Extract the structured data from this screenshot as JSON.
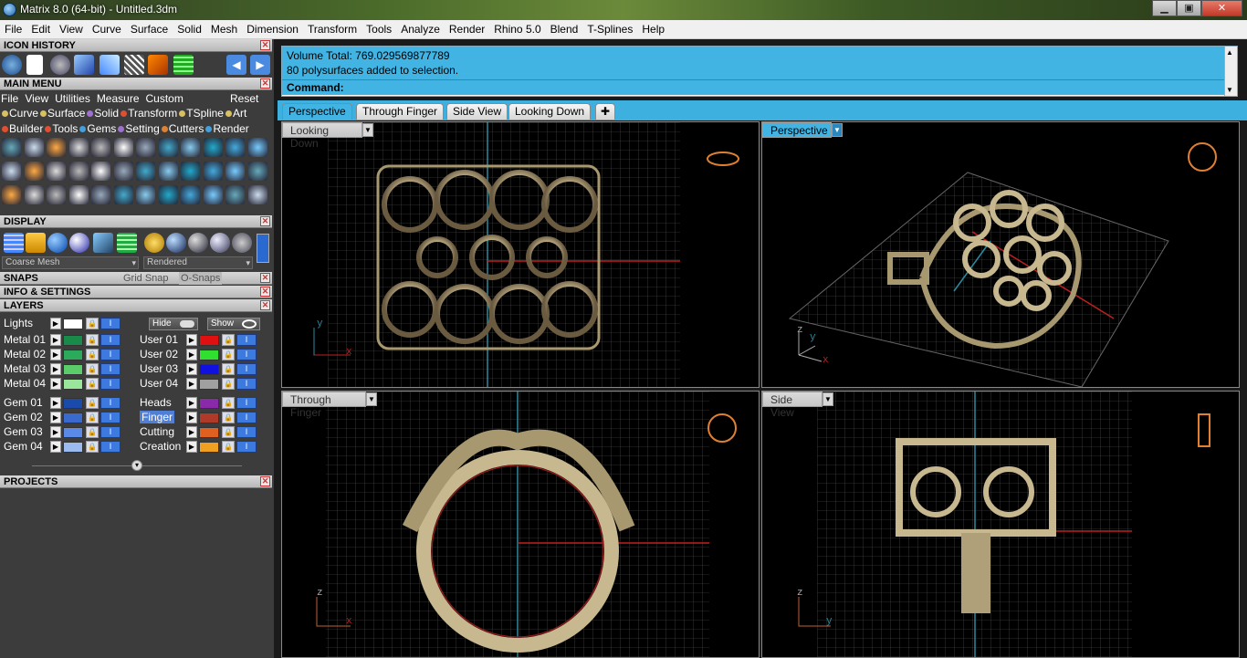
{
  "window": {
    "title": "Matrix 8.0 (64-bit) - Untitled.3dm",
    "minimize": "▁",
    "maximize": "▣",
    "close": "✕"
  },
  "menubar": [
    "File",
    "Edit",
    "View",
    "Curve",
    "Surface",
    "Solid",
    "Mesh",
    "Dimension",
    "Transform",
    "Tools",
    "Analyze",
    "Render",
    "Rhino 5.0",
    "Blend",
    "T-Splines",
    "Help"
  ],
  "panels": {
    "icon_history": "ICON HISTORY",
    "main_menu": "MAIN MENU",
    "display": "DISPLAY",
    "snaps": "SNAPS",
    "info_settings": "INFO & SETTINGS",
    "layers": "LAYERS",
    "projects": "PROJECTS"
  },
  "main_menu": {
    "menu": [
      "File",
      "View",
      "Utilities",
      "Measure",
      "Custom"
    ],
    "reset": "Reset",
    "row1": [
      {
        "label": "Curve",
        "color": "#d8c060"
      },
      {
        "label": "Surface",
        "color": "#d8c060"
      },
      {
        "label": "Solid",
        "color": "#a070d0"
      },
      {
        "label": "Transform",
        "color": "#e05030"
      },
      {
        "label": "TSpline",
        "color": "#d8c060"
      },
      {
        "label": "Art",
        "color": "#d8c060"
      }
    ],
    "row2": [
      {
        "label": "Builder",
        "color": "#e05030"
      },
      {
        "label": "Tools",
        "color": "#e05030"
      },
      {
        "label": "Gems",
        "color": "#40a0e0"
      },
      {
        "label": "Setting",
        "color": "#a070d0"
      },
      {
        "label": "Cutters",
        "color": "#e08030"
      },
      {
        "label": "Render",
        "color": "#40a0e0"
      }
    ]
  },
  "display": {
    "mesh": "Coarse Mesh",
    "mode": "Rendered"
  },
  "snaps": {
    "grid": "Grid Snap",
    "osnap": "O-Snaps"
  },
  "layers": {
    "hide": "Hide",
    "show": "Show",
    "left": [
      {
        "name": "Lights",
        "color": "#ffffff"
      },
      {
        "name": "Metal 01",
        "color": "#1a8a4a"
      },
      {
        "name": "Metal 02",
        "color": "#2aaa5a"
      },
      {
        "name": "Metal 03",
        "color": "#5acd6a"
      },
      {
        "name": "Metal 04",
        "color": "#9ae69a"
      },
      {
        "name": "Gem 01",
        "color": "#1a4aaa"
      },
      {
        "name": "Gem 02",
        "color": "#3a6acd"
      },
      {
        "name": "Gem 03",
        "color": "#5a8ae6"
      },
      {
        "name": "Gem 04",
        "color": "#9abaf0"
      }
    ],
    "right": [
      {
        "name": "User 01",
        "color": "#e01010"
      },
      {
        "name": "User 02",
        "color": "#30e030"
      },
      {
        "name": "User 03",
        "color": "#1010e0"
      },
      {
        "name": "User 04",
        "color": "#a0a0a0"
      },
      {
        "name": "Heads",
        "color": "#8a2aaa"
      },
      {
        "name": "Finger",
        "color": "#b03a2a"
      },
      {
        "name": "Cutting",
        "color": "#e06020"
      },
      {
        "name": "Creation",
        "color": "#f0a020"
      }
    ]
  },
  "command": {
    "line1": "Volume Total: 769.029569877789",
    "line2": "80 polysurfaces added to selection.",
    "prompt": "Command:"
  },
  "tabs": [
    "Perspective",
    "Through Finger",
    "Side View",
    "Looking Down"
  ],
  "viewports": {
    "top_left": {
      "label": "Looking Down",
      "x": "x",
      "y": "y"
    },
    "top_right": {
      "label": "Perspective",
      "x": "x",
      "y": "y",
      "z": "z"
    },
    "bottom_left": {
      "label": "Through Finger",
      "x": "x",
      "z": "z"
    },
    "bottom_right": {
      "label": "Side View",
      "y": "y",
      "z": "z"
    }
  },
  "colors": {
    "accent": "#41b4e4",
    "axis_red": "#c02020",
    "axis_blue": "#2a8aa0",
    "metal": "#c8b890"
  }
}
